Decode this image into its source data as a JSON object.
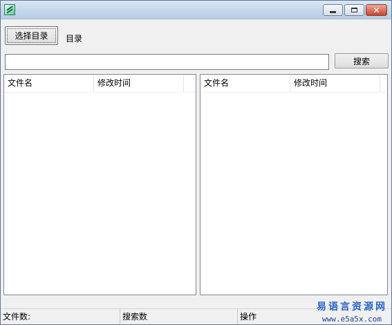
{
  "window": {
    "title": ""
  },
  "toolbar": {
    "select_dir_label": "选择目录",
    "dir_label": "目录"
  },
  "search": {
    "value": "",
    "button_label": "搜索"
  },
  "left_list": {
    "columns": [
      "文件名",
      "修改时间"
    ],
    "rows": []
  },
  "right_list": {
    "columns": [
      "文件名",
      "修改时间"
    ],
    "rows": []
  },
  "status": {
    "file_count_label": "文件数:",
    "search_count_label": "搜索数",
    "operation_label": "操作"
  },
  "watermark": {
    "text": "易语言资源网",
    "url": "www.e5a5x.com"
  },
  "colors": {
    "close_button": "#c9452d",
    "titlebar": "#c8d8ea",
    "watermark": "#2a63c8"
  },
  "icons": {
    "app": "app-icon",
    "minimize": "minimize-icon",
    "maximize": "maximize-icon",
    "close": "close-icon"
  }
}
